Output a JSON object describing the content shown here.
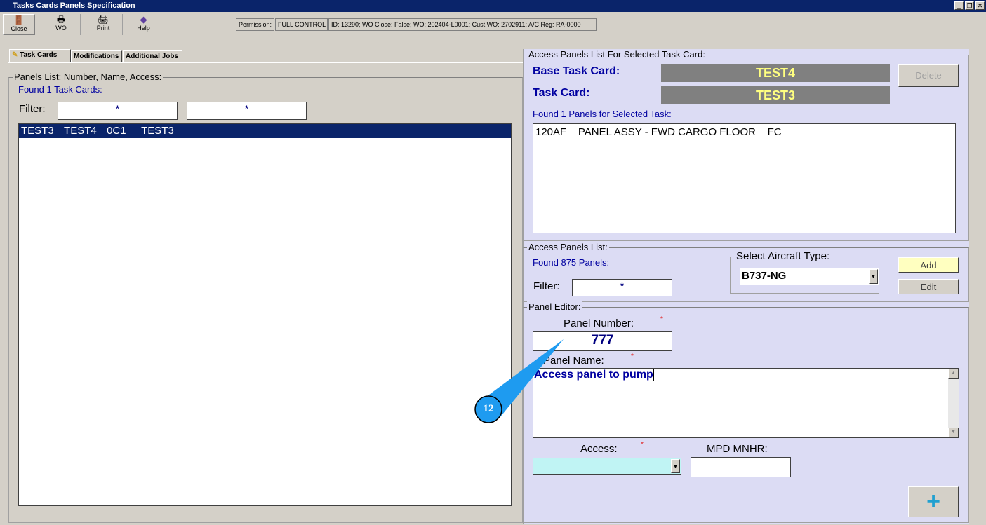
{
  "window": {
    "title": "Tasks Cards Panels Specification",
    "controls": [
      "_",
      "❐",
      "✕"
    ]
  },
  "toolbar": {
    "buttons": [
      {
        "label": "Close",
        "icon": "exit-door-icon"
      },
      {
        "label": "WO",
        "icon": "printer-doc-icon"
      },
      {
        "label": "Print",
        "icon": "printer-icon"
      },
      {
        "label": "Help",
        "icon": "help-book-icon"
      }
    ],
    "permission_label": "Permission:",
    "permission_value": "FULL CONTROL",
    "info": "ID: 13290; WO Close: False; WO: 202404-L0001; Cust.WO: 2702911; A/C Reg: RA-0000"
  },
  "tabs": [
    {
      "label": "Task Cards",
      "active": true
    },
    {
      "label": "Modifications"
    },
    {
      "label": "Additional Jobs"
    }
  ],
  "left": {
    "legend": "Panels List: Number, Name, Access:",
    "found": "Found 1 Task Cards:",
    "filter_label": "Filter:",
    "filter1": "*",
    "filter2": "*",
    "rows": [
      {
        "cols": [
          "TEST3",
          "TEST4",
          "0C1",
          "TEST3"
        ],
        "selected": true
      }
    ]
  },
  "right": {
    "legend": "Access Panels List For Selected Task Card:",
    "base_label": "Base Task Card:",
    "base_value": "TEST4",
    "task_label": "Task Card:",
    "task_value": "TEST3",
    "delete": "Delete",
    "found": "Found 1 Panels for Selected Task:",
    "panels": [
      "120AF    PANEL ASSY - FWD CARGO FLOOR    FC"
    ]
  },
  "apl": {
    "legend": "Access Panels List:",
    "found": "Found 875 Panels:",
    "filter_label": "Filter:",
    "filter": "*",
    "aircraft_legend": "Select Aircraft Type:",
    "aircraft": "B737-NG",
    "add": "Add",
    "edit": "Edit"
  },
  "editor": {
    "legend": "Panel Editor:",
    "number_label": "Panel Number:",
    "number": "777",
    "name_label": "Panel Name:",
    "name": "Access panel to pump",
    "access_label": "Access:",
    "access": "",
    "mnhr_label": "MPD MNHR:",
    "mnhr": "",
    "required": "*",
    "add_icon": "+"
  },
  "callout": {
    "number": "12",
    "color": "#1e9bf0"
  }
}
